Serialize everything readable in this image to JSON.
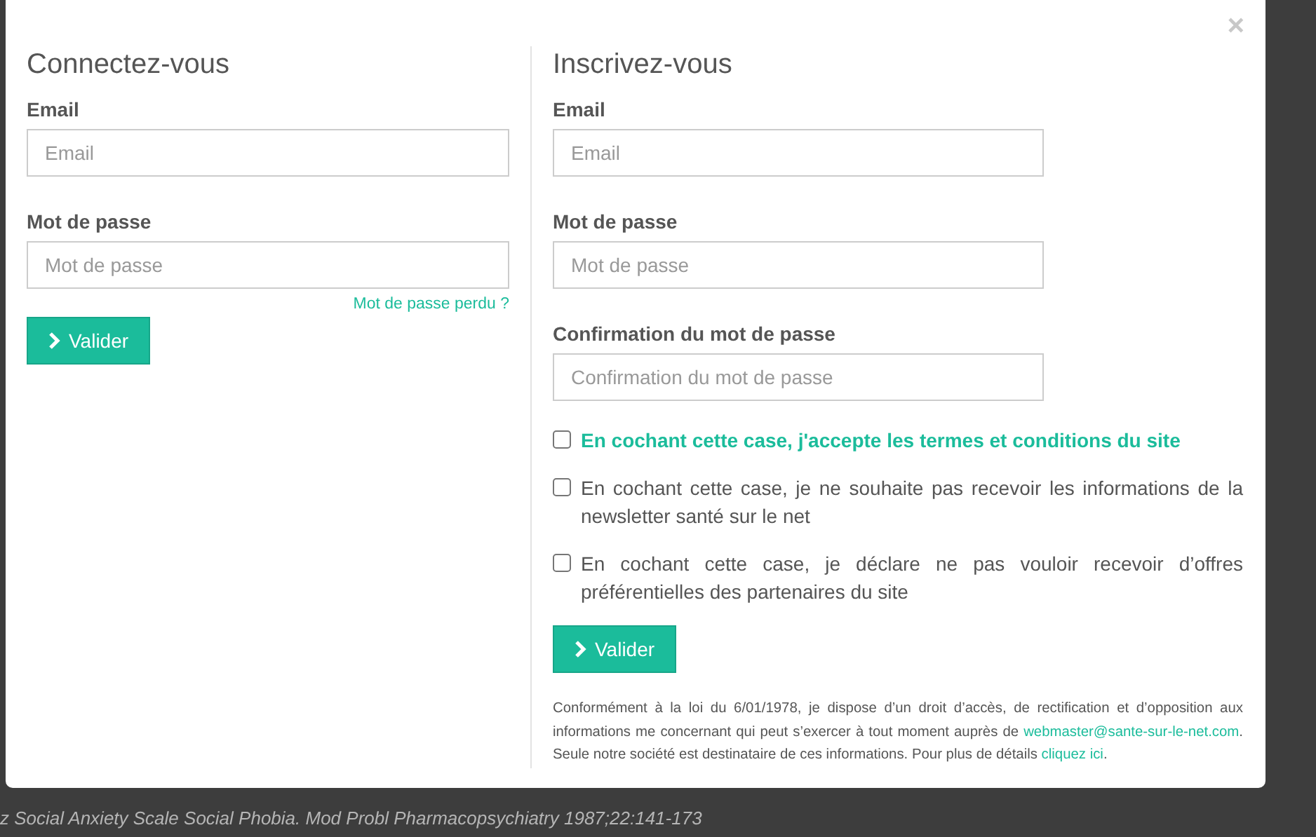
{
  "background_text": "z Social Anxiety Scale Social Phobia. Mod Probl Pharmacopsychiatry 1987;22:141-173",
  "close": "×",
  "login": {
    "title": "Connectez-vous",
    "fields": [
      {
        "label": "Email",
        "placeholder": "Email"
      },
      {
        "label": "Mot de passe",
        "placeholder": "Mot de passe"
      }
    ],
    "forgot_link": "Mot de passe perdu ?",
    "submit": "Valider"
  },
  "register": {
    "title": "Inscrivez-vous",
    "fields": [
      {
        "label": "Email",
        "placeholder": "Email"
      },
      {
        "label": "Mot de passe",
        "placeholder": "Mot de passe"
      },
      {
        "label": "Confirmation du mot de passe",
        "placeholder": "Confirmation du mot de passe"
      }
    ],
    "checkboxes": [
      {
        "label": "En cochant cette case, j'accepte les termes et conditions du site",
        "checked": false,
        "highlighted": true
      },
      {
        "label": "En cochant cette case, je ne souhaite pas recevoir les informations de la newsletter santé sur le net",
        "checked": false,
        "highlighted": false
      },
      {
        "label": "En cochant cette case, je déclare ne pas vouloir recevoir d’offres préférentielles des partenaires du site",
        "checked": false,
        "highlighted": false
      }
    ],
    "submit": "Valider",
    "legal": [
      {
        "kind": "text",
        "text": "Conformément à la loi du 6/01/1978, je dispose d’un droit d’accès, de rectification et d’opposition aux informations me concernant qui peut s’exercer à tout moment auprès de "
      },
      {
        "kind": "link",
        "text": "webmaster@sante-sur-le-net.com"
      },
      {
        "kind": "text",
        "text": ". Seule notre société est destinataire de ces informations. Pour plus de détails "
      },
      {
        "kind": "link",
        "text": "cliquez ici"
      },
      {
        "kind": "text",
        "text": "."
      }
    ]
  }
}
